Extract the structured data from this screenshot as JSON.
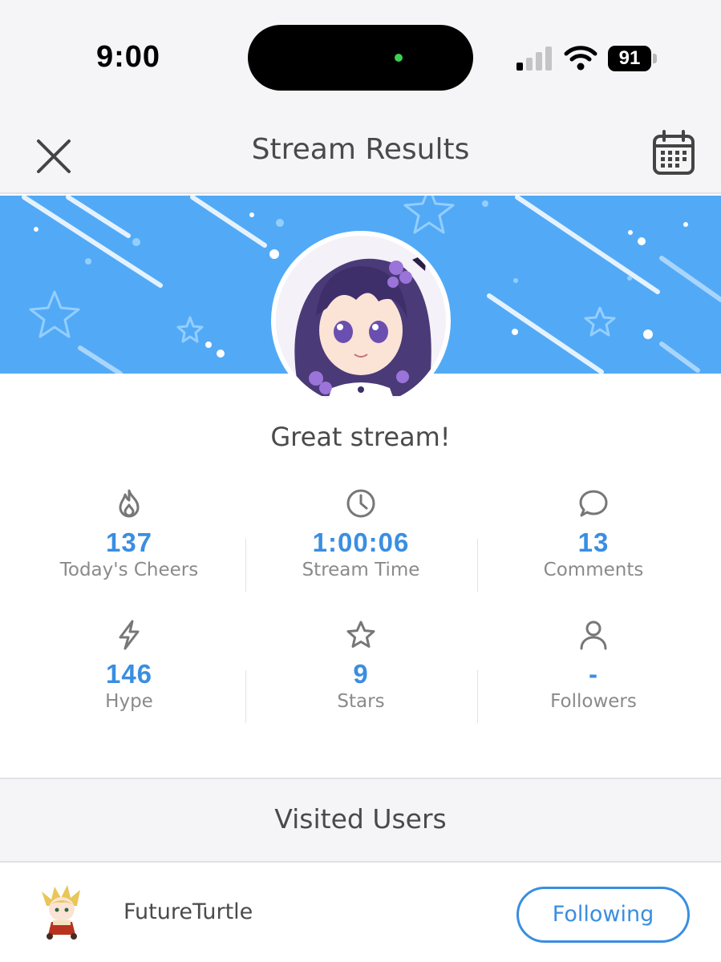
{
  "status_bar": {
    "time": "9:00",
    "battery": "91",
    "icons": [
      "signal-icon",
      "wifi-icon",
      "battery-icon"
    ]
  },
  "header": {
    "title": "Stream Results",
    "close_icon": "close-icon",
    "calendar_icon": "calendar-icon"
  },
  "banner": {
    "background_color": "#52aaf6",
    "avatar": "streamer-avatar"
  },
  "message": "Great stream!",
  "stats": [
    {
      "icon": "flame-icon",
      "value": "137",
      "label": "Today's Cheers"
    },
    {
      "icon": "clock-icon",
      "value": "1:00:06",
      "label": "Stream Time"
    },
    {
      "icon": "comment-icon",
      "value": "13",
      "label": "Comments"
    },
    {
      "icon": "lightning-icon",
      "value": "146",
      "label": "Hype"
    },
    {
      "icon": "star-icon",
      "value": "9",
      "label": "Stars"
    },
    {
      "icon": "user-icon",
      "value": "-",
      "label": "Followers"
    }
  ],
  "visited_users": {
    "title": "Visited Users",
    "users": [
      {
        "name": "FutureTurtle",
        "button_label": "Following"
      }
    ]
  },
  "colors": {
    "accent": "#3a8ee0",
    "banner": "#52aaf6",
    "text": "#4a4a4a",
    "muted": "#8a8a8a"
  }
}
